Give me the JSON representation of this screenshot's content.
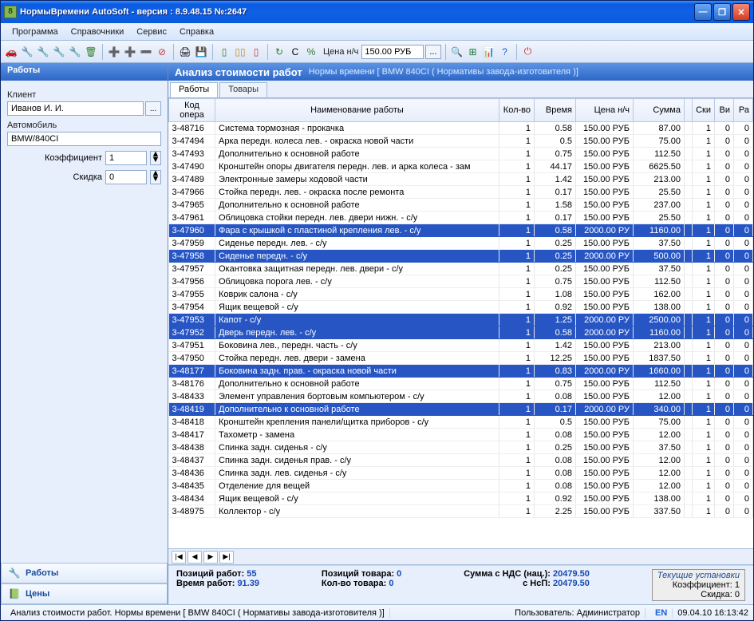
{
  "window": {
    "title": "НормыВремени AutoSoft  - версия : 8.9.48.15    №:2647"
  },
  "menu": [
    "Программа",
    "Справочники",
    "Сервис",
    "Справка"
  ],
  "toolbar": {
    "price_label": "Цена н/ч",
    "price_value": "150.00 РУБ",
    "ellipsis": "..."
  },
  "sidebar": {
    "header": "Работы",
    "client_label": "Клиент",
    "client_value": "Иванов И. И.",
    "car_label": "Автомобиль",
    "car_value": "BMW/840CI",
    "coef_label": "Коэффициент",
    "coef_value": "1",
    "discount_label": "Скидка",
    "discount_value": "0",
    "nav": [
      {
        "icon": "🔧",
        "label": "Работы"
      },
      {
        "icon": "📗",
        "label": "Цены"
      }
    ]
  },
  "main": {
    "header_title": "Анализ стоимости работ",
    "header_sub": "Нормы времени [ BMW 840CI ( Нормативы завода-изготовителя )]",
    "tabs": [
      "Работы",
      "Товары"
    ],
    "columns": [
      "Код опера",
      "Наименование работы",
      "Кол-во",
      "Время",
      "Цена н/ч",
      "Сумма",
      "",
      "Ски",
      "Ви",
      "Ра"
    ],
    "rows": [
      {
        "code": "3-48716",
        "name": "Система тормозная - прокачка",
        "qty": "1",
        "time": "0.58",
        "price": "150.00 РУБ",
        "sum": "87.00",
        "sk": "1",
        "vi": "0",
        "ra": "0"
      },
      {
        "code": "3-47494",
        "name": "Арка передн. колеса лев. - окраска новой части",
        "qty": "1",
        "time": "0.5",
        "price": "150.00 РУБ",
        "sum": "75.00",
        "sk": "1",
        "vi": "0",
        "ra": "0"
      },
      {
        "code": "3-47493",
        "name": "Дополнительно к основной работе",
        "qty": "1",
        "time": "0.75",
        "price": "150.00 РУБ",
        "sum": "112.50",
        "sk": "1",
        "vi": "0",
        "ra": "0"
      },
      {
        "code": "3-47490",
        "name": "Кронштейн опоры двигателя передн. лев. и арка колеса - зам",
        "qty": "1",
        "time": "44.17",
        "price": "150.00 РУБ",
        "sum": "6625.50",
        "sk": "1",
        "vi": "0",
        "ra": "0"
      },
      {
        "code": "3-47489",
        "name": "Электронные замеры ходовой части",
        "qty": "1",
        "time": "1.42",
        "price": "150.00 РУБ",
        "sum": "213.00",
        "sk": "1",
        "vi": "0",
        "ra": "0"
      },
      {
        "code": "3-47966",
        "name": "Стойка передн. лев. - окраска после ремонта",
        "qty": "1",
        "time": "0.17",
        "price": "150.00 РУБ",
        "sum": "25.50",
        "sk": "1",
        "vi": "0",
        "ra": "0"
      },
      {
        "code": "3-47965",
        "name": "Дополнительно к основной работе",
        "qty": "1",
        "time": "1.58",
        "price": "150.00 РУБ",
        "sum": "237.00",
        "sk": "1",
        "vi": "0",
        "ra": "0"
      },
      {
        "code": "3-47961",
        "name": "Облицовка стойки передн. лев. двери нижн. - с/у",
        "qty": "1",
        "time": "0.17",
        "price": "150.00 РУБ",
        "sum": "25.50",
        "sk": "1",
        "vi": "0",
        "ra": "0"
      },
      {
        "code": "3-47960",
        "name": "Фара с крышкой с пластиной крепления лев. - с/у",
        "qty": "1",
        "time": "0.58",
        "price": "2000.00 РУ",
        "sum": "1160.00",
        "sk": "1",
        "vi": "0",
        "ra": "0",
        "sel": true
      },
      {
        "code": "3-47959",
        "name": "Сиденье передн. лев. - с/у",
        "qty": "1",
        "time": "0.25",
        "price": "150.00 РУБ",
        "sum": "37.50",
        "sk": "1",
        "vi": "0",
        "ra": "0"
      },
      {
        "code": "3-47958",
        "name": "Сиденье передн. - с/у",
        "qty": "1",
        "time": "0.25",
        "price": "2000.00 РУ",
        "sum": "500.00",
        "sk": "1",
        "vi": "0",
        "ra": "0",
        "sel": true
      },
      {
        "code": "3-47957",
        "name": "Окантовка защитная передн. лев. двери - с/у",
        "qty": "1",
        "time": "0.25",
        "price": "150.00 РУБ",
        "sum": "37.50",
        "sk": "1",
        "vi": "0",
        "ra": "0"
      },
      {
        "code": "3-47956",
        "name": "Облицовка порога лев. - с/у",
        "qty": "1",
        "time": "0.75",
        "price": "150.00 РУБ",
        "sum": "112.50",
        "sk": "1",
        "vi": "0",
        "ra": "0"
      },
      {
        "code": "3-47955",
        "name": "Коврик салона - с/у",
        "qty": "1",
        "time": "1.08",
        "price": "150.00 РУБ",
        "sum": "162.00",
        "sk": "1",
        "vi": "0",
        "ra": "0"
      },
      {
        "code": "3-47954",
        "name": "Ящик вещевой - с/у",
        "qty": "1",
        "time": "0.92",
        "price": "150.00 РУБ",
        "sum": "138.00",
        "sk": "1",
        "vi": "0",
        "ra": "0"
      },
      {
        "code": "3-47953",
        "name": "Капот - с/у",
        "qty": "1",
        "time": "1.25",
        "price": "2000.00 РУ",
        "sum": "2500.00",
        "sk": "1",
        "vi": "0",
        "ra": "0",
        "sel": true
      },
      {
        "code": "3-47952",
        "name": "Дверь передн. лев. - с/у",
        "qty": "1",
        "time": "0.58",
        "price": "2000.00 РУ",
        "sum": "1160.00",
        "sk": "1",
        "vi": "0",
        "ra": "0",
        "sel": true
      },
      {
        "code": "3-47951",
        "name": "Боковина лев., передн. часть - с/у",
        "qty": "1",
        "time": "1.42",
        "price": "150.00 РУБ",
        "sum": "213.00",
        "sk": "1",
        "vi": "0",
        "ra": "0"
      },
      {
        "code": "3-47950",
        "name": "Стойка передн. лев. двери - замена",
        "qty": "1",
        "time": "12.25",
        "price": "150.00 РУБ",
        "sum": "1837.50",
        "sk": "1",
        "vi": "0",
        "ra": "0"
      },
      {
        "code": "3-48177",
        "name": "Боковина задн. прав. - окраска новой части",
        "qty": "1",
        "time": "0.83",
        "price": "2000.00 РУ",
        "sum": "1660.00",
        "sk": "1",
        "vi": "0",
        "ra": "0",
        "sel": true
      },
      {
        "code": "3-48176",
        "name": "Дополнительно к основной работе",
        "qty": "1",
        "time": "0.75",
        "price": "150.00 РУБ",
        "sum": "112.50",
        "sk": "1",
        "vi": "0",
        "ra": "0"
      },
      {
        "code": "3-48433",
        "name": "Элемент управления бортовым компьютером - с/у",
        "qty": "1",
        "time": "0.08",
        "price": "150.00 РУБ",
        "sum": "12.00",
        "sk": "1",
        "vi": "0",
        "ra": "0"
      },
      {
        "code": "3-48419",
        "name": "Дополнительно к основной работе",
        "qty": "1",
        "time": "0.17",
        "price": "2000.00 РУ",
        "sum": "340.00",
        "sk": "1",
        "vi": "0",
        "ra": "0",
        "sel": true
      },
      {
        "code": "3-48418",
        "name": "Кронштейн крепления панели/щитка приборов - с/у",
        "qty": "1",
        "time": "0.5",
        "price": "150.00 РУБ",
        "sum": "75.00",
        "sk": "1",
        "vi": "0",
        "ra": "0"
      },
      {
        "code": "3-48417",
        "name": "Тахометр - замена",
        "qty": "1",
        "time": "0.08",
        "price": "150.00 РУБ",
        "sum": "12.00",
        "sk": "1",
        "vi": "0",
        "ra": "0"
      },
      {
        "code": "3-48438",
        "name": "Спинка задн. сиденья - с/у",
        "qty": "1",
        "time": "0.25",
        "price": "150.00 РУБ",
        "sum": "37.50",
        "sk": "1",
        "vi": "0",
        "ra": "0"
      },
      {
        "code": "3-48437",
        "name": "Спинка задн. сиденья прав. - с/у",
        "qty": "1",
        "time": "0.08",
        "price": "150.00 РУБ",
        "sum": "12.00",
        "sk": "1",
        "vi": "0",
        "ra": "0"
      },
      {
        "code": "3-48436",
        "name": "Спинка задн. лев. сиденья - с/у",
        "qty": "1",
        "time": "0.08",
        "price": "150.00 РУБ",
        "sum": "12.00",
        "sk": "1",
        "vi": "0",
        "ra": "0"
      },
      {
        "code": "3-48435",
        "name": "Отделение для вещей",
        "qty": "1",
        "time": "0.08",
        "price": "150.00 РУБ",
        "sum": "12.00",
        "sk": "1",
        "vi": "0",
        "ra": "0"
      },
      {
        "code": "3-48434",
        "name": "Ящик вещевой - с/у",
        "qty": "1",
        "time": "0.92",
        "price": "150.00 РУБ",
        "sum": "138.00",
        "sk": "1",
        "vi": "0",
        "ra": "0"
      },
      {
        "code": "3-48975",
        "name": "Коллектор - с/у",
        "qty": "1",
        "time": "2.25",
        "price": "150.00 РУБ",
        "sum": "337.50",
        "sk": "1",
        "vi": "0",
        "ra": "0"
      }
    ]
  },
  "summary": {
    "pos_work_label": "Позиций работ:",
    "pos_work": "55",
    "time_work_label": "Время работ:",
    "time_work": "91.39",
    "pos_goods_label": "Позиций товара:",
    "pos_goods": "0",
    "qty_goods_label": "Кол-во товара:",
    "qty_goods": "0",
    "sum_nds_label": "Сумма с НДС (нац.):",
    "sum_nds": "20479.50",
    "sum_nsp_label": "с НсП:",
    "sum_nsp": "20479.50",
    "settings_title": "Текущие установки",
    "settings_coef": "Коэффициент: 1",
    "settings_discount": "Скидка: 0"
  },
  "status": {
    "text": "Анализ стоимости работ. Нормы времени [ BMW 840CI ( Нормативы завода-изготовителя )]",
    "user": "Пользователь: Администратор",
    "lang": "EN",
    "date": "09.04.10 16:13:42"
  }
}
